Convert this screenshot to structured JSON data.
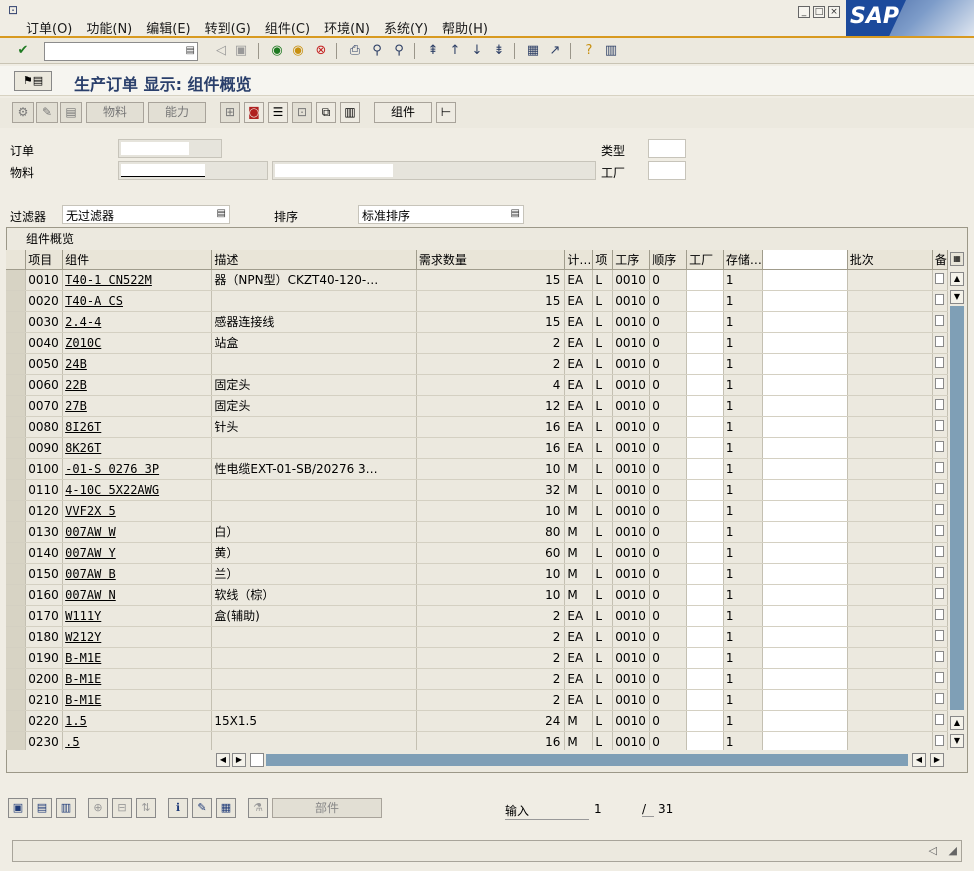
{
  "menu": [
    "订单(O)",
    "功能(N)",
    "编辑(E)",
    "转到(G)",
    "组件(C)",
    "环境(N)",
    "系统(Y)",
    "帮助(H)"
  ],
  "window_controls": [
    "□",
    "▫",
    "⊠"
  ],
  "logo_text": "SAP",
  "title": "生产订单 显示: 组件概览",
  "toolbar2": {
    "material_label": "物料",
    "capacity_label": "能力",
    "components_label": "组件"
  },
  "header": {
    "order_label": "订单",
    "material_label": "物料",
    "type_label": "类型",
    "plant_label": "工厂",
    "filter_label": "过滤器",
    "filter_value": "无过滤器",
    "sort_label": "排序",
    "sort_value": "标准排序"
  },
  "grid": {
    "title": "组件概览",
    "columns": [
      "项目",
      "组件",
      "描述",
      "需求数量",
      "计…",
      "项",
      "工序",
      "顺序",
      "工厂",
      "存储…",
      "",
      "批次",
      "备"
    ],
    "rows": [
      {
        "item": "0010",
        "comp": "T40-1       CN522M",
        "desc": "器（NPN型）CKZT40-120-…",
        "qty": "15",
        "unit": "EA",
        "cat": "L",
        "op": "0010",
        "seq": "0",
        "plant": "",
        "sloc": "1"
      },
      {
        "item": "0020",
        "comp": "T40-A       CS",
        "desc": "",
        "qty": "15",
        "unit": "EA",
        "cat": "L",
        "op": "0010",
        "seq": "0",
        "plant": "",
        "sloc": "1"
      },
      {
        "item": "0030",
        "comp": "2.4-4",
        "desc": "感器连接线",
        "qty": "15",
        "unit": "EA",
        "cat": "L",
        "op": "0010",
        "seq": "0",
        "plant": "",
        "sloc": "1"
      },
      {
        "item": "0040",
        "comp": "Z010C",
        "desc": "站盒",
        "qty": "2",
        "unit": "EA",
        "cat": "L",
        "op": "0010",
        "seq": "0",
        "plant": "",
        "sloc": "1"
      },
      {
        "item": "0050",
        "comp": "24B",
        "desc": "",
        "qty": "2",
        "unit": "EA",
        "cat": "L",
        "op": "0010",
        "seq": "0",
        "plant": "",
        "sloc": "1"
      },
      {
        "item": "0060",
        "comp": "22B",
        "desc": "固定头",
        "qty": "4",
        "unit": "EA",
        "cat": "L",
        "op": "0010",
        "seq": "0",
        "plant": "",
        "sloc": "1"
      },
      {
        "item": "0070",
        "comp": "27B",
        "desc": "固定头",
        "qty": "12",
        "unit": "EA",
        "cat": "L",
        "op": "0010",
        "seq": "0",
        "plant": "",
        "sloc": "1"
      },
      {
        "item": "0080",
        "comp": "8I26T",
        "desc": "针头",
        "qty": "16",
        "unit": "EA",
        "cat": "L",
        "op": "0010",
        "seq": "0",
        "plant": "",
        "sloc": "1"
      },
      {
        "item": "0090",
        "comp": "8K26T",
        "desc": "",
        "qty": "16",
        "unit": "EA",
        "cat": "L",
        "op": "0010",
        "seq": "0",
        "plant": "",
        "sloc": "1"
      },
      {
        "item": "0100",
        "comp": "-01-S     0276 3P",
        "desc": "性电缆EXT-01-SB/20276 3…",
        "qty": "10",
        "unit": "M",
        "cat": "L",
        "op": "0010",
        "seq": "0",
        "plant": "",
        "sloc": "1"
      },
      {
        "item": "0110",
        "comp": "4-10C     5X22AWG",
        "desc": "",
        "qty": "32",
        "unit": "M",
        "cat": "L",
        "op": "0010",
        "seq": "0",
        "plant": "",
        "sloc": "1"
      },
      {
        "item": "0120",
        "comp": "VVF2X     5",
        "desc": "",
        "qty": "10",
        "unit": "M",
        "cat": "L",
        "op": "0010",
        "seq": "0",
        "plant": "",
        "sloc": "1"
      },
      {
        "item": "0130",
        "comp": "007AW     W",
        "desc": "白）",
        "qty": "80",
        "unit": "M",
        "cat": "L",
        "op": "0010",
        "seq": "0",
        "plant": "",
        "sloc": "1"
      },
      {
        "item": "0140",
        "comp": "007AW     Y",
        "desc": "黄）",
        "qty": "60",
        "unit": "M",
        "cat": "L",
        "op": "0010",
        "seq": "0",
        "plant": "",
        "sloc": "1"
      },
      {
        "item": "0150",
        "comp": "007AW     B",
        "desc": "兰）",
        "qty": "10",
        "unit": "M",
        "cat": "L",
        "op": "0010",
        "seq": "0",
        "plant": "",
        "sloc": "1"
      },
      {
        "item": "0160",
        "comp": "007AW     N",
        "desc": "软线（棕）",
        "qty": "10",
        "unit": "M",
        "cat": "L",
        "op": "0010",
        "seq": "0",
        "plant": "",
        "sloc": "1"
      },
      {
        "item": "0170",
        "comp": "W111Y",
        "desc": "盒(辅助)",
        "qty": "2",
        "unit": "EA",
        "cat": "L",
        "op": "0010",
        "seq": "0",
        "plant": "",
        "sloc": "1"
      },
      {
        "item": "0180",
        "comp": "W212Y",
        "desc": "",
        "qty": "2",
        "unit": "EA",
        "cat": "L",
        "op": "0010",
        "seq": "0",
        "plant": "",
        "sloc": "1"
      },
      {
        "item": "0190",
        "comp": "B-M1E",
        "desc": "",
        "qty": "2",
        "unit": "EA",
        "cat": "L",
        "op": "0010",
        "seq": "0",
        "plant": "",
        "sloc": "1"
      },
      {
        "item": "0200",
        "comp": "B-M1E",
        "desc": "",
        "qty": "2",
        "unit": "EA",
        "cat": "L",
        "op": "0010",
        "seq": "0",
        "plant": "",
        "sloc": "1"
      },
      {
        "item": "0210",
        "comp": "B-M1E",
        "desc": "",
        "qty": "2",
        "unit": "EA",
        "cat": "L",
        "op": "0010",
        "seq": "0",
        "plant": "",
        "sloc": "1"
      },
      {
        "item": "0220",
        "comp": "1.5",
        "desc": "15X1.5",
        "qty": "24",
        "unit": "M",
        "cat": "L",
        "op": "0010",
        "seq": "0",
        "plant": "",
        "sloc": "1"
      },
      {
        "item": "0230",
        "comp": ".5",
        "desc": "",
        "qty": "16",
        "unit": "M",
        "cat": "L",
        "op": "0010",
        "seq": "0",
        "plant": "",
        "sloc": "1"
      }
    ]
  },
  "bottom": {
    "parts_label": "部件",
    "entry_label": "输入",
    "entry_value": "1",
    "separator": "/",
    "total": "31"
  }
}
